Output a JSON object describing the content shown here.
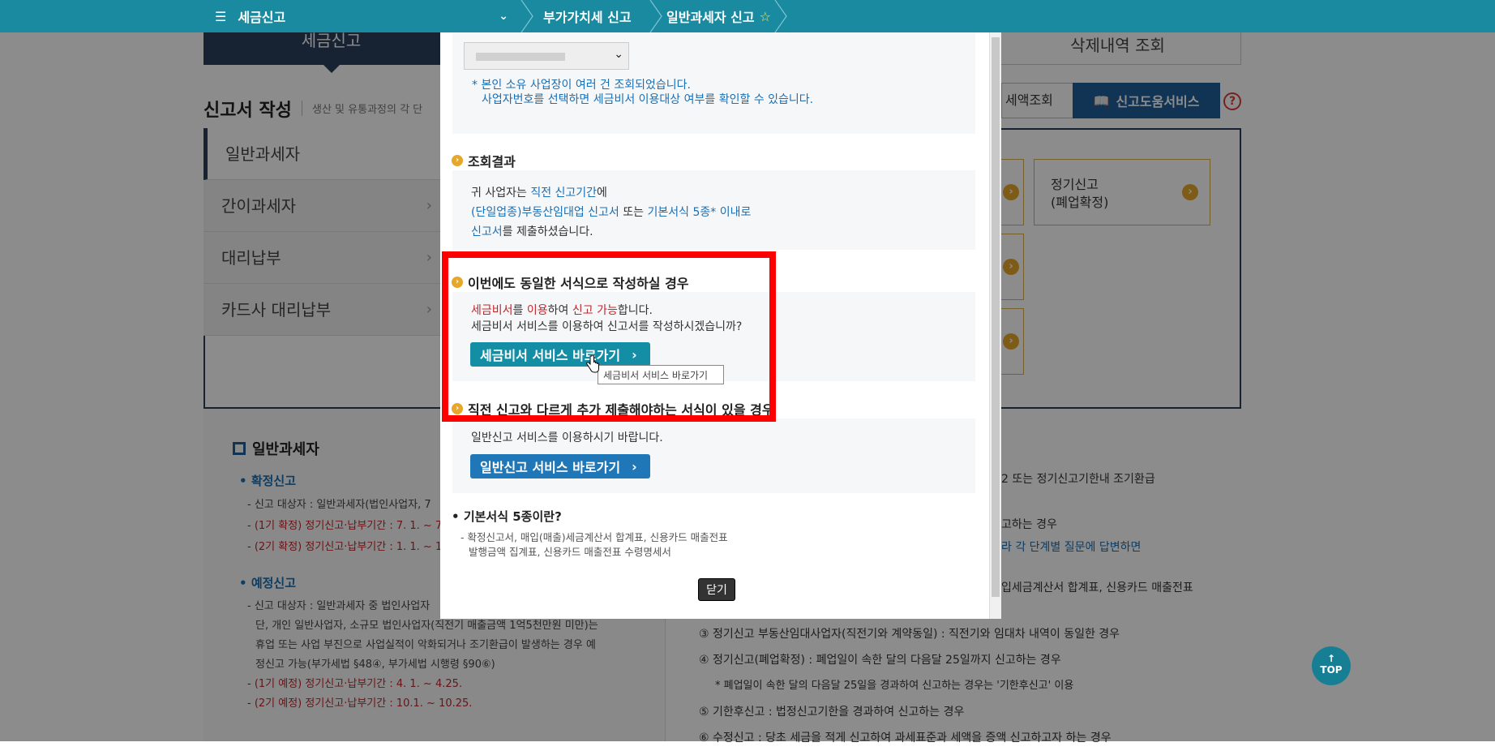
{
  "topbar": {
    "menu_label": "세금신고",
    "crumbs": [
      "부가가치세 신고",
      "일반과세자 신고"
    ]
  },
  "background": {
    "tabs": {
      "active": "세금신고",
      "other": "삭제내역 조회"
    },
    "section_title": "신고서 작성",
    "section_desc": "생산 및 유통과정의 각 단",
    "buttons": {
      "tax_lookup": "세액조회",
      "help_service": "신고도움서비스"
    },
    "sidebar": [
      {
        "label": "일반과세자"
      },
      {
        "label": "간이과세자"
      },
      {
        "label": "대리납부"
      },
      {
        "label": "카드사 대리납부"
      }
    ],
    "right_box": {
      "line1": "정기신고",
      "line2": "(폐업확정)"
    },
    "left_panel": {
      "title": "일반과세자",
      "confirm_title": "확정신고",
      "confirm_lines": [
        "신고 대상자 : 일반과세자(법인사업자, 7",
        "(1기 확정) 정기신고·납부기간 : 7. 1. ~ 7",
        "(2기 확정) 정기신고·납부기간 : 1. 1. ~ 1"
      ],
      "prelim_title": "예정신고",
      "prelim_lines": [
        "신고 대상자 : 일반과세자 중 법인사업자",
        "단, 개인 일반사업자, 소규모 법인사업자(직전기 매출금액 1억5천만원 미만)는",
        "휴업 또는 사업 부진으로 사업실적이 악화되거나 조기환급이 발생하는 경우 예",
        "정신고 가능(부가세법 §48④, 부가세법 시행령 §90⑥)",
        "(1기 예정) 정기신고·납부기간 : 4. 1. ~ 4.25.",
        "(2기 예정) 정기신고·납부기간 : 10.1. ~ 10.25."
      ]
    },
    "right_panel": {
      "lines": [
        "2 또는 정기신고기한내 조기환급",
        "고하는 경우",
        "라 각 단계별 질문에 답변하면",
        "입세금계산서 합계표, 신용카드 매출전표",
        "③ 정기신고 부동산임대사업자(직전기와 계약동일) : 직전기와 임대차 내역이 동일한 경우",
        "④ 정기신고(폐업확정) : 폐업일이 속한 달의 다음달 25일까지 신고하는 경우",
        "* 폐업일이 속한 달의 다음달 25일을 경과하여 신고하는 경우는 '기한후신고' 이용",
        "⑤ 기한후신고 : 법정신고기한을 경과하여 신고하는 경우",
        "⑥ 수정신고 : 당초 세금을 적게 신고하여 과세표준과 세액을 증액 신고하고자 하는 경우"
      ]
    },
    "top_button": "TOP"
  },
  "modal": {
    "notice_lines": [
      "* 본인 소유 사업장이 여러 건 조회되었습니다.",
      "사업자번호를 선택하면 세금비서 이용대상 여부를 확인할 수 있습니다."
    ],
    "result_title": "조회결과",
    "result": {
      "p1": "귀 사업자는 ",
      "p1b": "직전 신고기간",
      "p1c": "에",
      "p2a": "(단일업종)부동산임대업 신고서",
      "p2b": " 또는 ",
      "p2c": "기본서식 5종* 이내로",
      "p3a": "신고서",
      "p3b": "를 제출하셨습니다."
    },
    "same_title": "이번에도 동일한 서식으로 작성하실 경우",
    "same": {
      "l1a": "세금비서",
      "l1b": "를 ",
      "l1c": "이용",
      "l1d": "하여 ",
      "l1e": "신고 가능",
      "l1f": "합니다.",
      "l2": "세금비서 서비스를 이용하여 신고서를 작성하시겠습니까?",
      "button": "세금비서 서비스 바로가기"
    },
    "tooltip": "세금비서 서비스 바로가기",
    "diff_title": "직전 신고와 다르게 추가 제출해야하는 서식이 있을 경우",
    "diff": {
      "text": "일반신고 서비스를 이용하시기 바랍니다.",
      "button": "일반신고 서비스 바로가기"
    },
    "basic_title": "기본서식 5종이란?",
    "basic_lines": [
      "- 확정신고서, 매입(매출)세금계산서 합계표, 신용카드 매출전표",
      "발행금액 집계표, 신용카드 매출전표 수령명세서"
    ],
    "close": "닫기"
  },
  "colors": {
    "topbar": "#1a8aa0",
    "teal_button": "#138ea5",
    "blue_button": "#1f77b8",
    "highlight": "#ff0000"
  }
}
